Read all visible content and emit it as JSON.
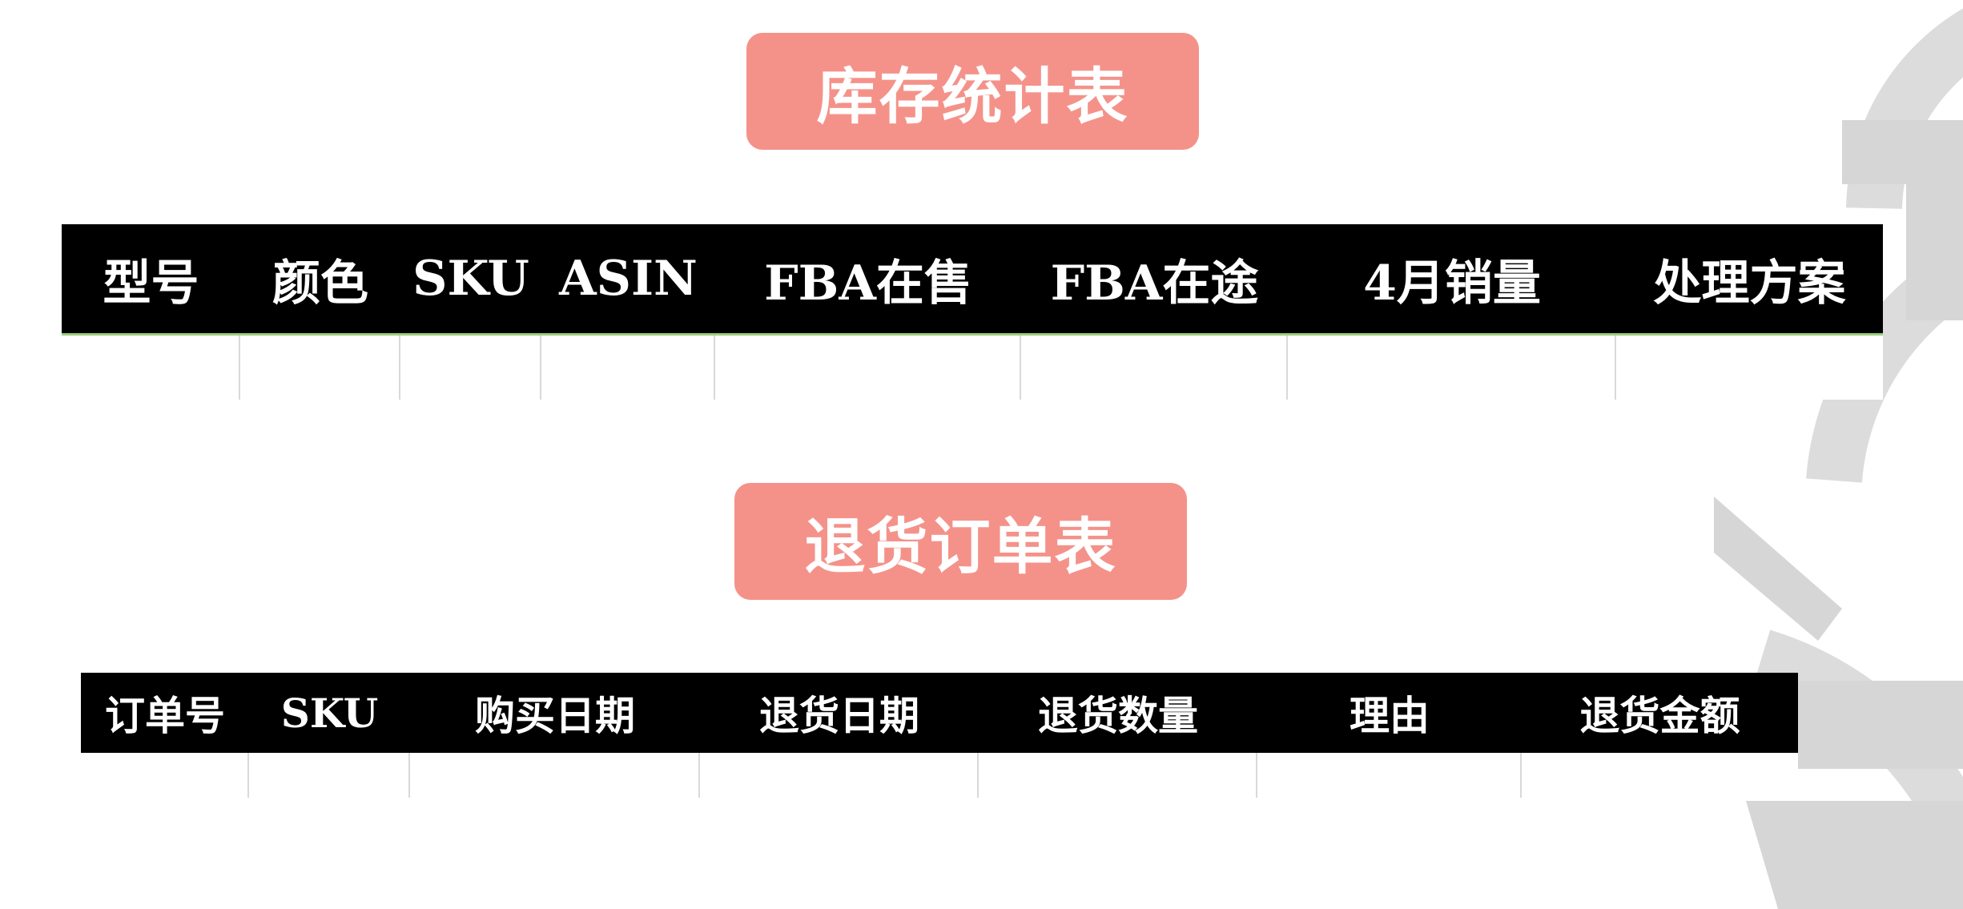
{
  "inventory_table": {
    "title": "库存统计表",
    "headers": [
      "型号",
      "颜色",
      "SKU",
      "ASIN",
      "FBA在售",
      "FBA在途",
      "4月销量",
      "处理方案"
    ]
  },
  "returns_table": {
    "title": "退货订单表",
    "headers": [
      "订单号",
      "SKU",
      "购买日期",
      "退货日期",
      "退货数量",
      "理由",
      "退货金额"
    ]
  },
  "colors": {
    "title_pill": "#f4928a",
    "header_bg": "#000000",
    "header_text": "#ffffff",
    "grid_line": "#d9d9d9"
  }
}
